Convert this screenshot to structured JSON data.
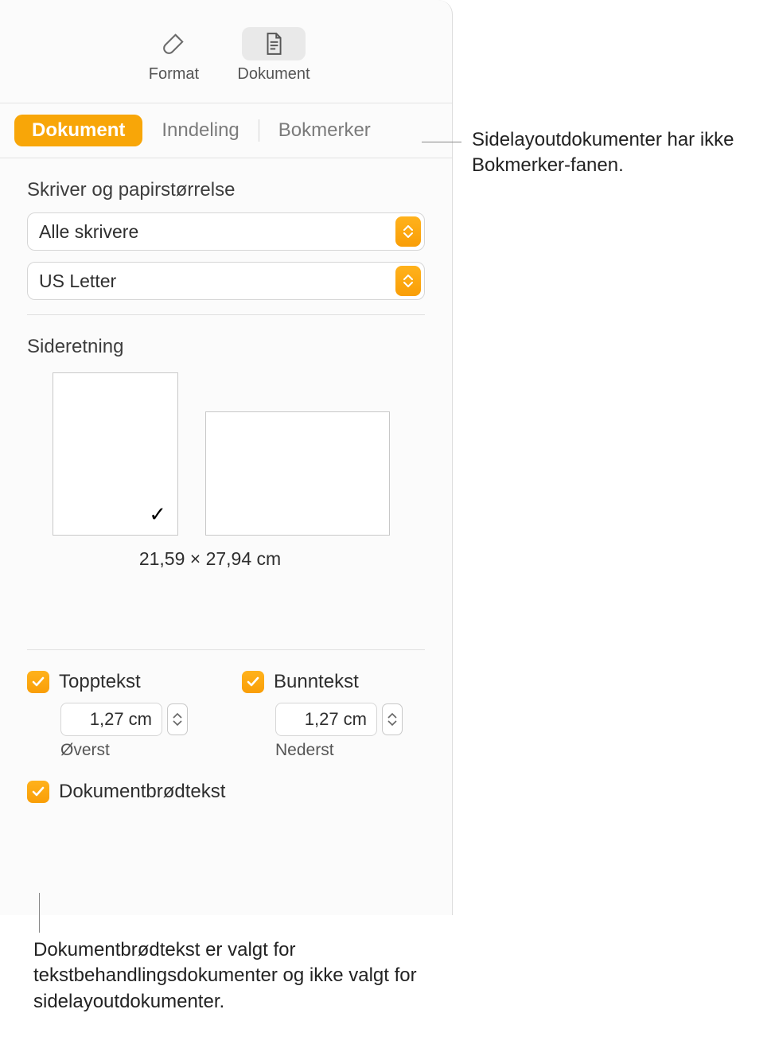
{
  "toolbar": {
    "format_label": "Format",
    "document_label": "Dokument"
  },
  "tabs": {
    "document": "Dokument",
    "section": "Inndeling",
    "bookmarks": "Bokmerker"
  },
  "printer": {
    "section_label": "Skriver og papirstørrelse",
    "printer_value": "Alle skrivere",
    "paper_value": "US Letter"
  },
  "orientation": {
    "section_label": "Sideretning",
    "dimensions": "21,59 × 27,94 cm"
  },
  "header": {
    "label": "Topptekst",
    "value": "1,27 cm",
    "sublabel": "Øverst"
  },
  "footer": {
    "label": "Bunntekst",
    "value": "1,27 cm",
    "sublabel": "Nederst"
  },
  "bodytext": {
    "label": "Dokumentbrødtekst"
  },
  "callouts": {
    "bookmarks": "Sidelayoutdokumenter har ikke Bokmerker-fanen.",
    "bodytext": "Dokumentbrødtekst er valgt for tekstbehandlingsdokumenter og ikke valgt for sidelayoutdokumenter."
  }
}
